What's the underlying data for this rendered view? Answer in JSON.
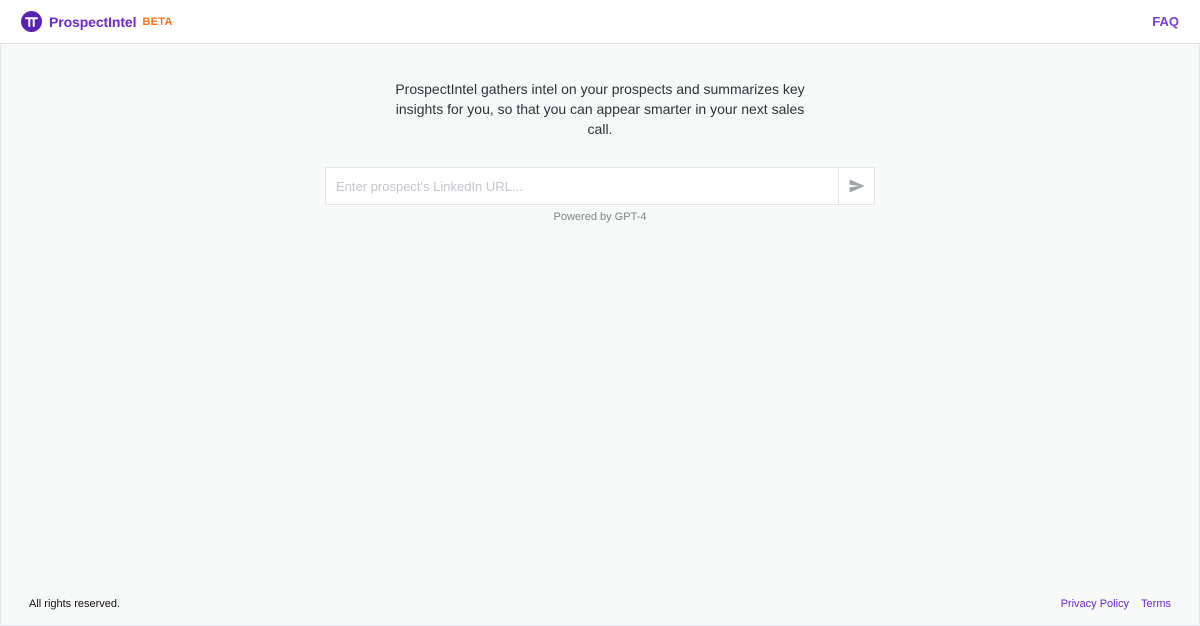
{
  "header": {
    "brand_name": "ProspectIntel",
    "badge": "BETA",
    "logo_glyph": "π",
    "faq_label": "FAQ"
  },
  "main": {
    "intro_text": "ProspectIntel gathers intel on your prospects and summarizes key insights for you, so that you can appear smarter in your next sales call.",
    "search": {
      "placeholder": "Enter prospect's LinkedIn URL...",
      "value": "",
      "submit_icon": "send-icon"
    },
    "powered_by": "Powered by GPT-4"
  },
  "footer": {
    "copyright": "All rights reserved.",
    "links": [
      "Privacy Policy",
      "Terms"
    ]
  },
  "colors": {
    "brand_purple": "#6d28d9",
    "logo_purple": "#5b21b6",
    "badge_orange": "#f97316",
    "link_purple": "#7c3aed",
    "page_background": "#f8f9f9"
  }
}
